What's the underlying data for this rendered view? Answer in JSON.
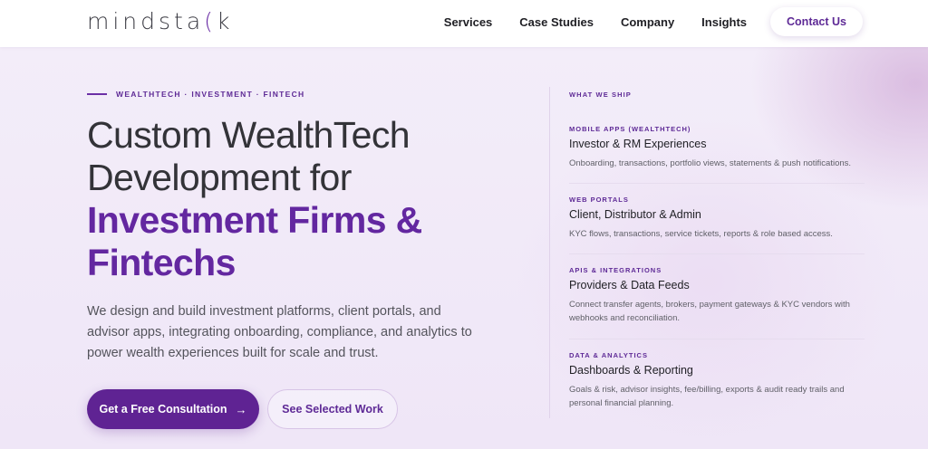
{
  "header": {
    "logo": "mindsta",
    "logo_c": "(",
    "logo_end": "k",
    "nav": [
      "Services",
      "Case Studies",
      "Company",
      "Insights"
    ],
    "cta": "Contact Us"
  },
  "hero": {
    "eyebrow": "WEALTHTECH · INVESTMENT · FINTECH",
    "headline_line1": "Custom WealthTech",
    "headline_line2": "Development for",
    "headline_accent1": "Investment Firms &",
    "headline_accent2": "Fintechs",
    "lede": "We design and build investment platforms, client portals, and advisor apps, integrating onboarding, compliance, and analytics to power wealth experiences built for scale and trust.",
    "primary_button": "Get a Free Consultation",
    "primary_arrow": "→",
    "secondary_button": "See Selected Work"
  },
  "ship": {
    "title": "WHAT WE SHIP",
    "items": [
      {
        "category": "MOBILE APPS (WEALTHTECH)",
        "heading": "Investor & RM Experiences",
        "description": "Onboarding, transactions, portfolio views, statements & push notifications."
      },
      {
        "category": "WEB PORTALS",
        "heading": "Client, Distributor & Admin",
        "description": "KYC flows, transactions, service tickets, reports & role based access."
      },
      {
        "category": "APIS & INTEGRATIONS",
        "heading": "Providers & Data Feeds",
        "description": "Connect transfer agents, brokers, payment gateways & KYC vendors with webhooks and reconciliation."
      },
      {
        "category": "DATA & ANALYTICS",
        "heading": "Dashboards & Reporting",
        "description": "Goals & risk, advisor insights, fee/billing, exports & audit ready trails and personal financial planning."
      }
    ]
  },
  "colors": {
    "accent": "#6327a0",
    "primary_button": "#5f2393",
    "background": "#f3edf9"
  }
}
